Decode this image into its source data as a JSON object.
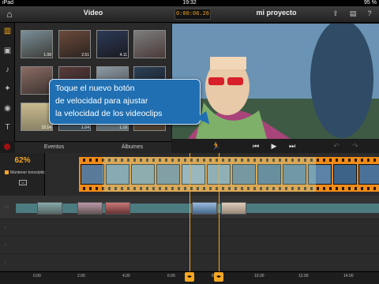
{
  "status_bar": {
    "device": "iPad",
    "time": "19:32",
    "battery": "95 %"
  },
  "header": {
    "media_title": "Vídeo",
    "timecode": "0:00:06.26",
    "project_title": "mi proyecto"
  },
  "media_browser": {
    "thumbnails": [
      {
        "duration": "1.08"
      },
      {
        "duration": "2.51"
      },
      {
        "duration": "4.11"
      },
      {
        "duration": ""
      },
      {
        "duration": ""
      },
      {
        "duration": ""
      },
      {
        "duration": ""
      },
      {
        "duration": ""
      },
      {
        "duration": "15.14"
      },
      {
        "duration": "1.04"
      },
      {
        "duration": "1.18"
      },
      {
        "duration": ""
      }
    ],
    "tabs": [
      "Eventos",
      "Álbumes"
    ]
  },
  "tooltip": {
    "lines": [
      "Toque el nuevo botón",
      "de velocidad para ajustar",
      "la velocidad de los videoclips"
    ]
  },
  "clip_settings": {
    "speed_percent": "62%",
    "keep_pitch_label": "Mantener tonos/pitch"
  },
  "timeline": {
    "ruler_ticks": [
      "0.00",
      "2.00",
      "4.00",
      "6.00",
      "8.00",
      "10.00",
      "12.00",
      "14.00"
    ]
  },
  "colors": {
    "accent": "#f5a623",
    "filmstrip": "#f08c1a",
    "tooltip": "#1f6fb2"
  },
  "icons": {
    "home": "home-icon",
    "speed": "running-man-icon",
    "skip_back": "skip-back-icon",
    "play": "play-icon",
    "skip_forward": "skip-forward-icon"
  }
}
